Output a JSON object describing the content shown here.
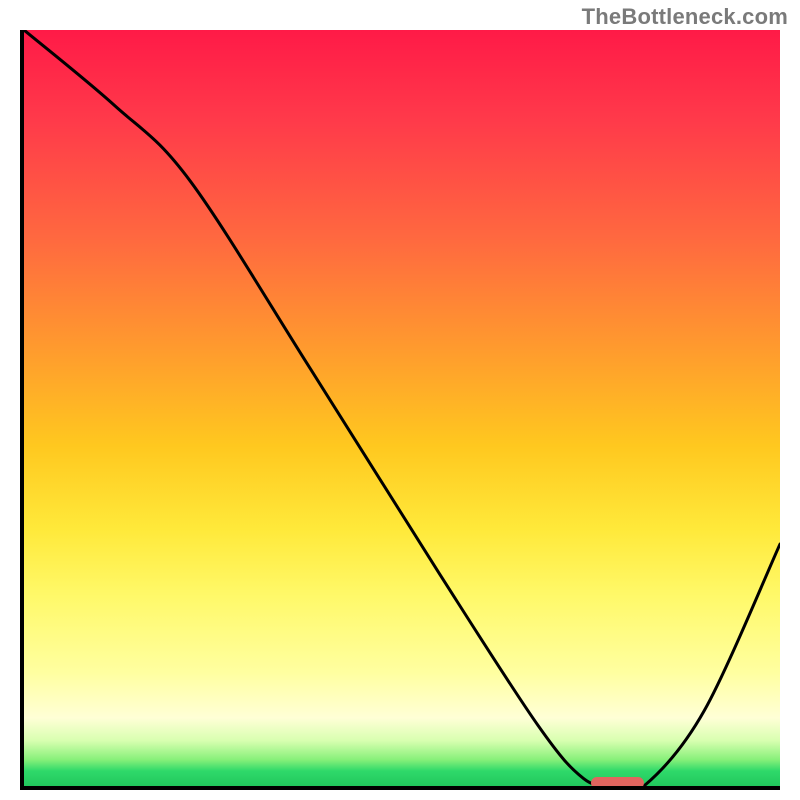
{
  "watermark": "TheBottleneck.com",
  "chart_data": {
    "type": "line",
    "title": "",
    "xlabel": "",
    "ylabel": "",
    "xlim": [
      0,
      100
    ],
    "ylim": [
      0,
      100
    ],
    "x": [
      0,
      12,
      22,
      38,
      55,
      68,
      74,
      78,
      82,
      90,
      100
    ],
    "values": [
      100,
      90,
      80,
      55,
      28,
      8,
      1,
      0,
      0,
      10,
      32
    ],
    "marker_segment": {
      "x_start": 75,
      "x_end": 82,
      "y": 0
    },
    "gradient_stops": [
      {
        "offset": 0.0,
        "color": "#ff1a47"
      },
      {
        "offset": 0.55,
        "color": "#ffc81f"
      },
      {
        "offset": 0.85,
        "color": "#ffffa0"
      },
      {
        "offset": 0.97,
        "color": "#88f07a"
      },
      {
        "offset": 1.0,
        "color": "#21c85d"
      }
    ]
  }
}
